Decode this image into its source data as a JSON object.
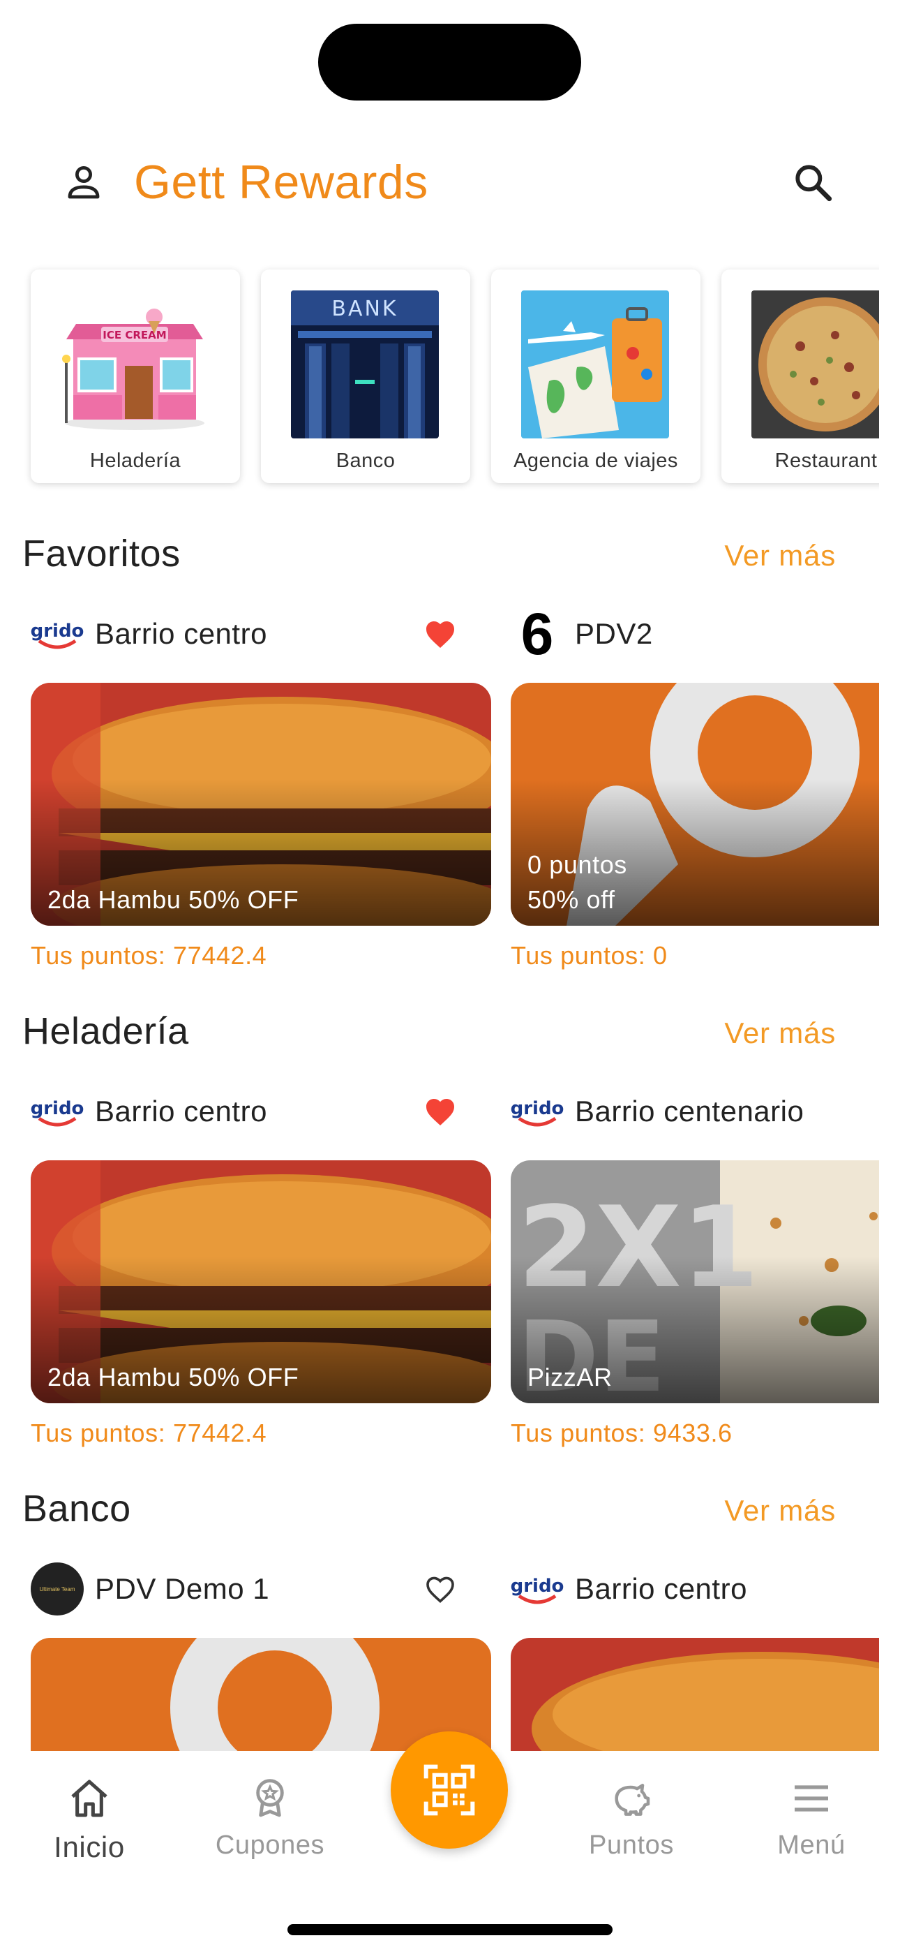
{
  "app": {
    "title": "Gett Rewards"
  },
  "categories": [
    {
      "label": "Heladería",
      "icon": "ice-cream-shop"
    },
    {
      "label": "Banco",
      "icon": "bank"
    },
    {
      "label": "Agencia de viajes",
      "icon": "travel"
    },
    {
      "label": "Restaurant",
      "icon": "pizza"
    }
  ],
  "sections": [
    {
      "title": "Favoritos",
      "see_more": "Ver más",
      "stores": [
        {
          "name": "Barrio centro",
          "logo_text": "grido",
          "favorite": true,
          "caption": "2da Hambu 50% OFF",
          "points": "Tus puntos: 77442.4"
        },
        {
          "name": "PDV2",
          "logo_text": "6",
          "caption_line1": "0 puntos",
          "caption": "50% off",
          "points": "Tus puntos: 0"
        }
      ]
    },
    {
      "title": "Heladería",
      "see_more": "Ver más",
      "stores": [
        {
          "name": "Barrio centro",
          "logo_text": "grido",
          "favorite": true,
          "caption": "2da Hambu 50% OFF",
          "points": "Tus puntos: 77442.4"
        },
        {
          "name": "Barrio centenario",
          "logo_text": "grido",
          "caption": "PizzAR",
          "points": "Tus puntos: 9433.6"
        }
      ]
    },
    {
      "title": "Banco",
      "see_more": "Ver más",
      "stores": [
        {
          "name": "PDV Demo 1",
          "logo_text": "Ultimate Team",
          "favorite": false
        },
        {
          "name": "Barrio centro",
          "logo_text": "grido"
        }
      ]
    }
  ],
  "promo_art": {
    "pizza_text": "2X1",
    "pizza_text2": "DE"
  },
  "tabs": [
    {
      "label": "Inicio",
      "icon": "home-icon",
      "active": true
    },
    {
      "label": "Cupones",
      "icon": "coupon-icon"
    },
    {
      "label": "",
      "icon": "qr-scan-icon"
    },
    {
      "label": "Puntos",
      "icon": "piggy-bank-icon"
    },
    {
      "label": "Menú",
      "icon": "menu-icon"
    }
  ],
  "colors": {
    "accent": "#f08a1a",
    "fab": "#ff9800",
    "heart": "#f44336"
  }
}
